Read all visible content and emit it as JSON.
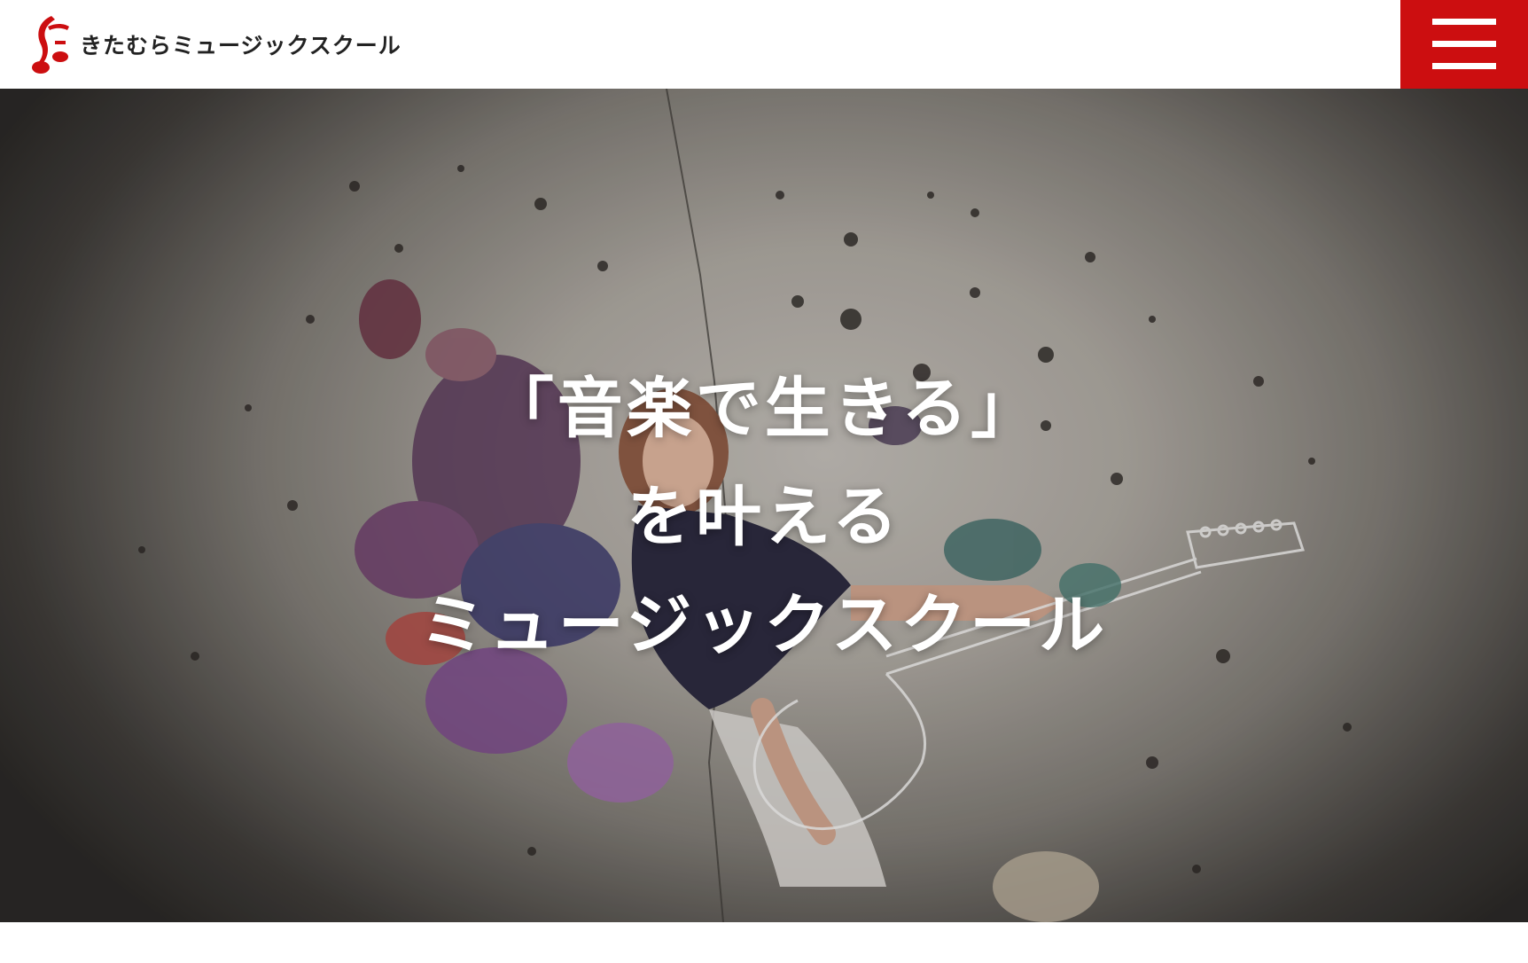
{
  "header": {
    "logo_text": "きたむらミュージックスクール",
    "menu_icon": "hamburger-menu-icon",
    "accent_color": "#cc0e10"
  },
  "hero": {
    "lines": [
      "「音楽で生きる」",
      "を叶える",
      "ミュージックスクール"
    ],
    "image": "singer-with-guitar-and-paint-splash"
  }
}
